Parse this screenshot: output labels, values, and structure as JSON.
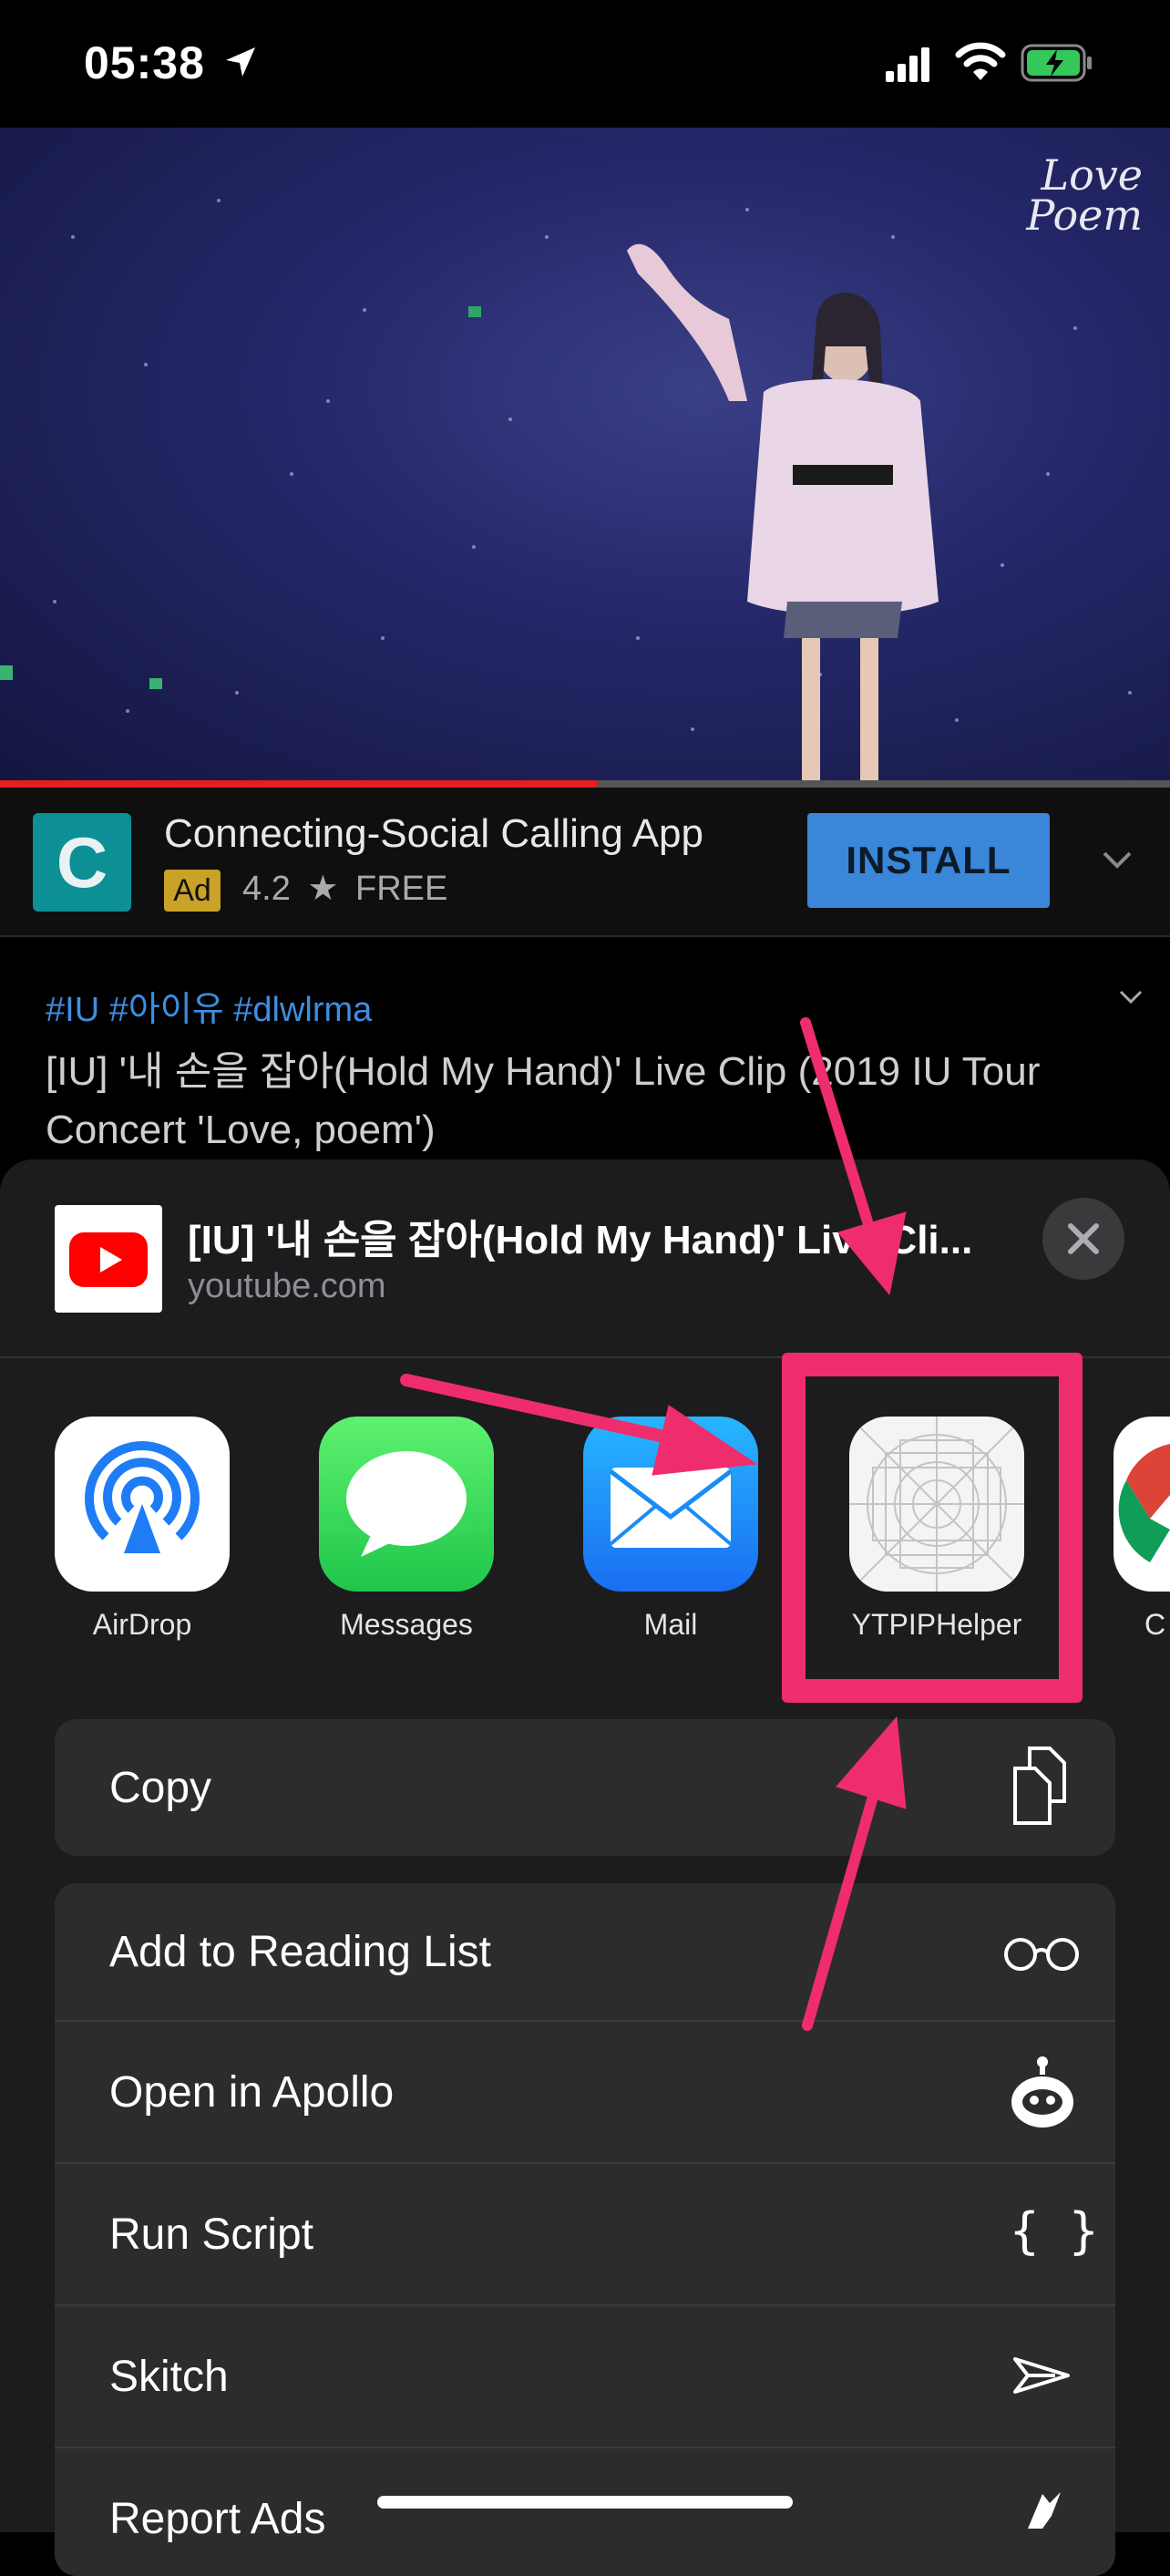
{
  "status_bar": {
    "time": "05:38"
  },
  "video": {
    "logo_line1": "Love",
    "logo_line2": "Poem",
    "progress_fraction": 0.51
  },
  "ad": {
    "logo_letter": "C",
    "title": "Connecting-Social Calling App",
    "badge": "Ad",
    "rating": "4.2",
    "star": "★",
    "price": "FREE",
    "install_label": "INSTALL"
  },
  "description": {
    "hashtags": "#IU #아이유 #dlwlrma",
    "title": "[IU] '내 손을 잡아(Hold My Hand)' Live Clip (2019 IU Tour Concert 'Love, poem')"
  },
  "share_sheet": {
    "title": "[IU] '내 손을 잡아(Hold My Hand)' Live Cli...",
    "url": "youtube.com",
    "apps": [
      {
        "label": "AirDrop"
      },
      {
        "label": "Messages"
      },
      {
        "label": "Mail"
      },
      {
        "label": "YTPIPHelper"
      },
      {
        "label": "C"
      }
    ],
    "copy_label": "Copy",
    "actions": [
      {
        "label": "Add to Reading List",
        "icon": "glasses-icon"
      },
      {
        "label": "Open in Apollo",
        "icon": "apollo-icon"
      },
      {
        "label": "Run Script",
        "icon": "braces-icon",
        "glyph": "{ }"
      },
      {
        "label": "Skitch",
        "icon": "skitch-icon"
      },
      {
        "label": "Report Ads",
        "icon": "report-ads-icon"
      }
    ]
  },
  "annotation": {
    "color": "#ef2d6c"
  }
}
